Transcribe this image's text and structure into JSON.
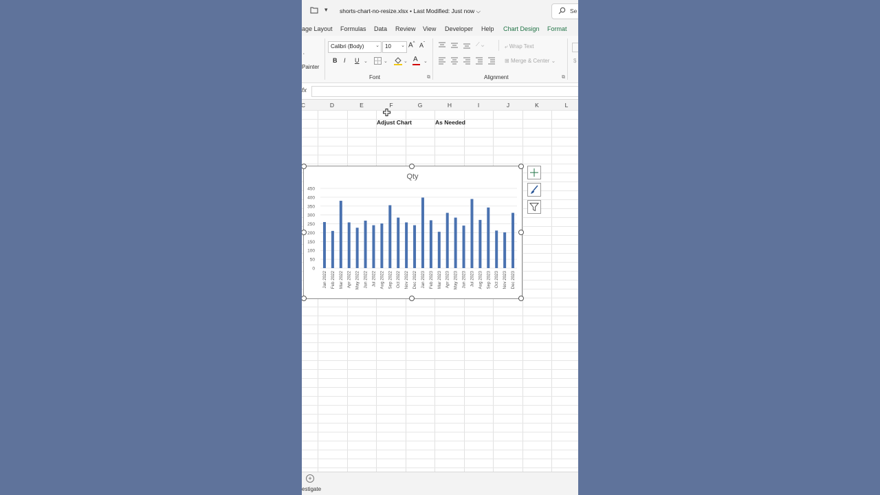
{
  "window": {
    "doc_title": "shorts-chart-no-resize.xlsx • Last Modified: Just now",
    "search_label": "Se"
  },
  "tabs": [
    {
      "label": "age Layout"
    },
    {
      "label": "Formulas"
    },
    {
      "label": "Data"
    },
    {
      "label": "Review"
    },
    {
      "label": "View"
    },
    {
      "label": "Developer"
    },
    {
      "label": "Help"
    },
    {
      "label": "Chart Design"
    },
    {
      "label": "Format"
    }
  ],
  "ribbon": {
    "clipboard": {
      "painter_label": "Painter"
    },
    "font": {
      "name": "Calibri (Body)",
      "size": "10",
      "group_label": "Font",
      "grow": "A",
      "shrink": "A",
      "bold": "B",
      "italic": "I",
      "underline": "U",
      "font_color_letter": "A"
    },
    "alignment": {
      "wrap_text": "Wrap Text",
      "merge_center": "Merge & Center",
      "group_label": "Alignment"
    }
  },
  "formula_bar": {
    "fx": "fx",
    "value": ""
  },
  "columns": [
    "C",
    "D",
    "E",
    "F",
    "G",
    "H",
    "I",
    "J",
    "K",
    "L"
  ],
  "cells": {
    "adjust_chart": "Adjust Chart",
    "as_needed": "As Needed"
  },
  "statusbar": {
    "text": "estigate"
  },
  "colors": {
    "bar": "#4a72b0",
    "accent": "#217346"
  },
  "chart_data": {
    "type": "bar",
    "title": "Qty",
    "categories": [
      "Jan 2022",
      "Feb 2022",
      "Mar 2022",
      "Apr 2022",
      "May 2022",
      "Jun 2022",
      "Jul 2022",
      "Aug 2022",
      "Sep 2022",
      "Oct 2022",
      "Nov 2022",
      "Dec 2022",
      "Jan 2023",
      "Feb 2023",
      "Mar 2023",
      "Apr 2023",
      "May 2023",
      "Jun 2023",
      "Jul 2023",
      "Aug 2023",
      "Sep 2023",
      "Oct 2023",
      "Nov 2023",
      "Dec 2023"
    ],
    "values": [
      260,
      210,
      380,
      258,
      228,
      268,
      242,
      252,
      355,
      285,
      258,
      242,
      398,
      270,
      205,
      312,
      285,
      240,
      390,
      272,
      342,
      212,
      202,
      312
    ],
    "ylim": [
      0,
      450
    ],
    "yticks": [
      "0",
      "50",
      "100",
      "150",
      "200",
      "250",
      "300",
      "350",
      "400",
      "450"
    ],
    "grid": true,
    "legend": "none"
  }
}
